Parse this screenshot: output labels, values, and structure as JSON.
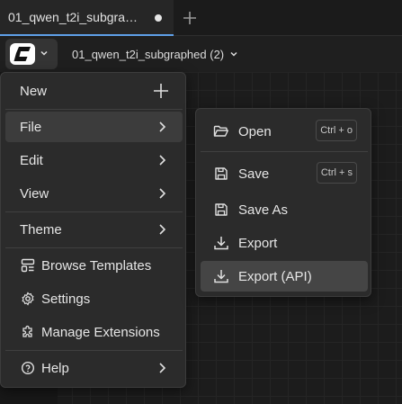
{
  "tab": {
    "title": "01_qwen_t2i_subgra…",
    "unsaved_dot": true
  },
  "header": {
    "workflow_name": "01_qwen_t2i_subgraphed (2)"
  },
  "icons": {
    "new_tab": "plus-icon",
    "logo": "comfy-logo-icon",
    "chevron": "chevron-down-icon",
    "arrow": "chevron-right-icon"
  },
  "menu": {
    "new": "New",
    "file": "File",
    "edit": "Edit",
    "view": "View",
    "theme": "Theme",
    "browse_templates": "Browse Templates",
    "settings": "Settings",
    "manage_extensions": "Manage Extensions",
    "help": "Help"
  },
  "file_menu": {
    "open": {
      "label": "Open",
      "shortcut": "Ctrl + o"
    },
    "save": {
      "label": "Save",
      "shortcut": "Ctrl + s"
    },
    "save_as": {
      "label": "Save As"
    },
    "export": {
      "label": "Export"
    },
    "export_api": {
      "label": "Export (API)"
    }
  },
  "colors": {
    "accent": "#5fa0e8",
    "menu_bg": "#2b2b2b",
    "active_bg": "#3c3c3c"
  }
}
